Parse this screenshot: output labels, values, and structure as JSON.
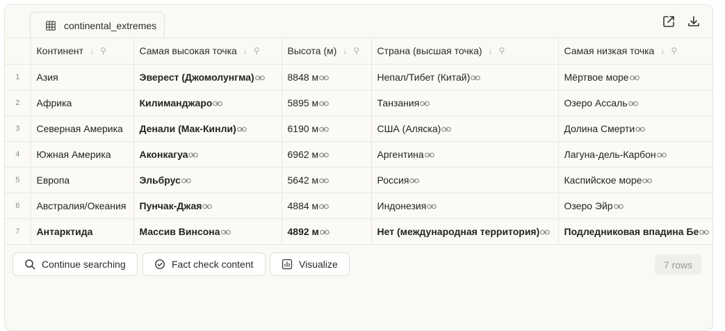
{
  "tab": {
    "label": "continental_extremes",
    "icon": "table-grid-icon"
  },
  "header_actions": [
    {
      "name": "open-external-icon"
    },
    {
      "name": "download-icon"
    }
  ],
  "table": {
    "columns": [
      "Континент",
      "Самая высокая точка",
      "Высота (м)",
      "Страна (высшая точка)",
      "Самая низкая точка"
    ],
    "rows": [
      {
        "n": "1",
        "cells": [
          "Азия",
          "Эверест (Джомолунгма)",
          "8848 м",
          "Непал/Тибет (Китай)",
          "Мёртвое море"
        ],
        "bold_all": false
      },
      {
        "n": "2",
        "cells": [
          "Африка",
          "Килиманджаро",
          "5895 м",
          "Танзания",
          "Озеро Ассаль"
        ],
        "bold_all": false
      },
      {
        "n": "3",
        "cells": [
          "Северная Америка",
          "Денали (Мак-Кинли)",
          "6190 м",
          "США (Аляска)",
          "Долина Смерти"
        ],
        "bold_all": false
      },
      {
        "n": "4",
        "cells": [
          "Южная Америка",
          "Аконкагуа",
          "6962 м",
          "Аргентина",
          "Лагуна-дель-Карбон"
        ],
        "bold_all": false
      },
      {
        "n": "5",
        "cells": [
          "Европа",
          "Эльбрус",
          "5642 м",
          "Россия",
          "Каспийское море"
        ],
        "bold_all": false
      },
      {
        "n": "6",
        "cells": [
          "Австралия/Океания",
          "Пунчак-Джая",
          "4884 м",
          "Индонезия",
          "Озеро Эйр"
        ],
        "bold_all": false
      },
      {
        "n": "7",
        "cells": [
          "Антарктида",
          "Массив Винсона",
          "4892 м",
          "Нет (международная территория)",
          "Подледниковая впадина Бе"
        ],
        "bold_all": true
      }
    ]
  },
  "footer": {
    "continue_label": "Continue searching",
    "factcheck_label": "Fact check content",
    "visualize_label": "Visualize",
    "rows_count": "7 rows"
  }
}
